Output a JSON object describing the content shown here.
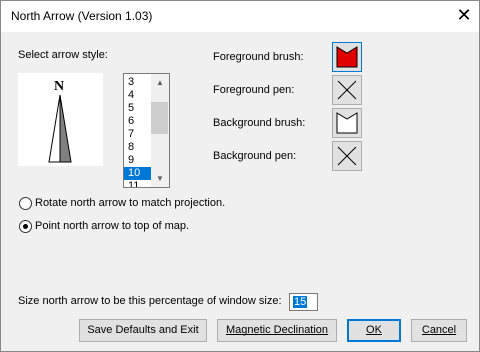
{
  "window": {
    "title": "North Arrow (Version 1.03)",
    "close_glyph": "✕"
  },
  "style_section": {
    "label": "Select arrow style:",
    "preview_letter": "N",
    "list_items": [
      "3",
      "4",
      "5",
      "6",
      "7",
      "8",
      "9",
      "10",
      "11"
    ],
    "selected_item": "10"
  },
  "brushes": {
    "foreground_brush": "Foreground brush:",
    "foreground_pen": "Foreground pen:",
    "background_brush": "Background brush:",
    "background_pen": "Background pen:"
  },
  "options": {
    "rotate_label": "Rotate north arrow to match projection.",
    "point_label": "Point north arrow to top of map.",
    "selected": "point"
  },
  "size": {
    "label": "Size north arrow to be this percentage of window size:",
    "value": "15"
  },
  "buttons": {
    "save_defaults": "Save Defaults and Exit",
    "magnetic_declination": "Magnetic Declination",
    "ok": "OK",
    "cancel": "Cancel"
  },
  "colors": {
    "accent": "#0078d7",
    "foreground_brush": "#e00000"
  }
}
